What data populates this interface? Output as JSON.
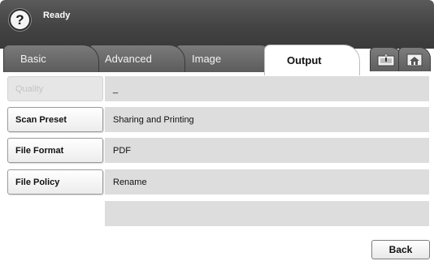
{
  "header": {
    "help_icon": "question-mark-icon",
    "help_glyph": "?",
    "status": "Ready"
  },
  "tabs": [
    {
      "label": "Basic",
      "selected": false
    },
    {
      "label": "Advanced",
      "selected": false
    },
    {
      "label": "Image",
      "selected": false
    },
    {
      "label": "Output",
      "selected": true
    }
  ],
  "icon_tabs": [
    {
      "icon": "job-status-icon"
    },
    {
      "icon": "home-icon"
    }
  ],
  "settings": [
    {
      "label": "Quality",
      "value": "_",
      "enabled": false
    },
    {
      "label": "Scan Preset",
      "value": "Sharing and Printing",
      "enabled": true
    },
    {
      "label": "File Format",
      "value": "PDF",
      "enabled": true
    },
    {
      "label": "File Policy",
      "value": "Rename",
      "enabled": true
    }
  ],
  "footer": {
    "back_label": "Back"
  },
  "colors": {
    "header": "#434343",
    "tab_inactive": "#6a6a6a",
    "row_background": "#dddddd",
    "disabled_text": "#c4c4c4"
  }
}
